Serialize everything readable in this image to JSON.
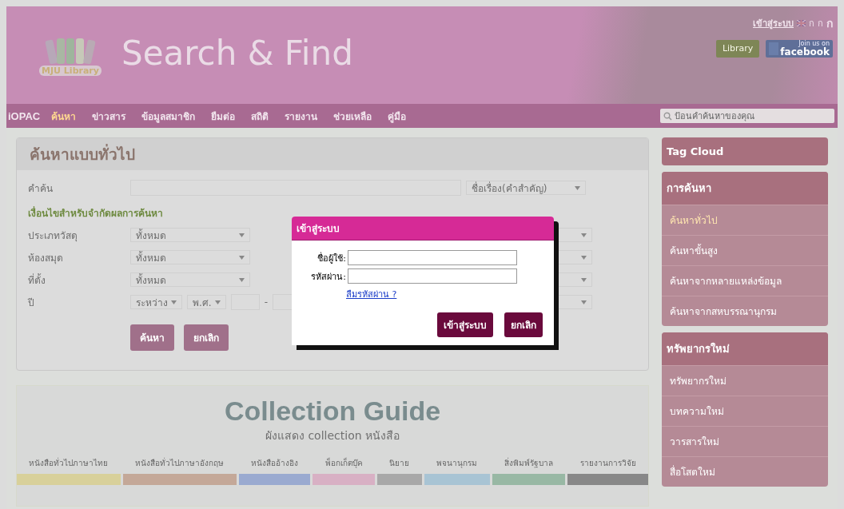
{
  "header": {
    "logo_text": "MJU Library",
    "title": "Search & Find",
    "login_link": "เข้าสู่ระบบ",
    "font_sizes": [
      "ก",
      "ก",
      "ก"
    ],
    "library_badge": "Library",
    "facebook_badge": {
      "caption": "Join us on",
      "label": "facebook"
    }
  },
  "nav": {
    "brand": "iOPAC",
    "items": [
      {
        "label": "ค้นหา",
        "selected": true
      },
      {
        "label": "ข่าวสาร",
        "selected": false
      },
      {
        "label": "ข้อมูลสมาชิก",
        "selected": false
      },
      {
        "label": "ยืมต่อ",
        "selected": false
      },
      {
        "label": "สถิติ",
        "selected": false
      },
      {
        "label": "รายงาน",
        "selected": false
      },
      {
        "label": "ช่วยเหลือ",
        "selected": false
      },
      {
        "label": "คู่มือ",
        "selected": false
      }
    ],
    "search": {
      "placeholder": "ป้อนคำค้นหาของคุณ"
    }
  },
  "search_panel": {
    "title": "ค้นหาแบบทั่วไป",
    "keyword_label": "คำค้น",
    "field_select": "ชื่อเรื่อง(คำสำคัญ)",
    "conditions_title": "เงื่อนไขสำหรับจำกัดผลการค้นหา",
    "filters": [
      {
        "label": "ประเภทวัสดุ",
        "value": "ทั้งหมด"
      },
      {
        "label": "ห้องสมุด",
        "value": "ทั้งหมด"
      },
      {
        "label": "ที่ตั้ง",
        "value": "ทั้งหมด"
      }
    ],
    "year": {
      "label": "ปี",
      "range": "ระหว่าง",
      "era": "พ.ศ.",
      "separator": "-"
    },
    "buttons": [
      "ค้นหา",
      "ยกเลิก"
    ]
  },
  "collection_guide": {
    "title": "Collection Guide",
    "subtitle": "ผังแสดง collection หนังสือ",
    "categories": [
      {
        "label": "หนังสือทั่วไปภาษาไทย",
        "color": "#d8d09a"
      },
      {
        "label": "หนังสือทั่วไปภาษาอังกฤษ",
        "color": "#c4a898"
      },
      {
        "label": "หนังสืออ้างอิง",
        "color": "#9aaad0"
      },
      {
        "label": "พ็อกเก็ตบุ๊ค",
        "color": "#d8b0c4"
      },
      {
        "label": "นิยาย",
        "color": "#a8a8a8"
      },
      {
        "label": "พจนานุกรม",
        "color": "#a8c4d4"
      },
      {
        "label": "สิ่งพิมพ์รัฐบาล",
        "color": "#98b8a4"
      },
      {
        "label": "รายงานการวิจัย",
        "color": "#888888"
      }
    ]
  },
  "sidebar": {
    "panels": [
      {
        "title": "Tag Cloud"
      },
      {
        "title": "การค้นหา",
        "items": [
          {
            "label": "ค้นหาทั่วไป",
            "selected": true
          },
          {
            "label": "ค้นหาขั้นสูง",
            "selected": false
          },
          {
            "label": "ค้นหาจากหลายแหล่งข้อมูล",
            "selected": false
          },
          {
            "label": "ค้นหาจากสหบรรณานุกรม",
            "selected": false
          }
        ]
      },
      {
        "title": "ทรัพยากรใหม่",
        "items": [
          {
            "label": "ทรัพยากรใหม่",
            "selected": false
          },
          {
            "label": "บทความใหม่",
            "selected": false
          },
          {
            "label": "วารสารใหม่",
            "selected": false
          },
          {
            "label": "สื่อโสตใหม่",
            "selected": false
          }
        ]
      }
    ]
  },
  "login_dialog": {
    "title": "เข้าสู่ระบบ",
    "username_label": "ชื่อผู้ใช้:",
    "password_label": "รหัสผ่าน:",
    "forgot_link": "ลืมรหัสผ่าน ?",
    "buttons": [
      "เข้าสู่ระบบ",
      "ยกเลิก"
    ]
  }
}
